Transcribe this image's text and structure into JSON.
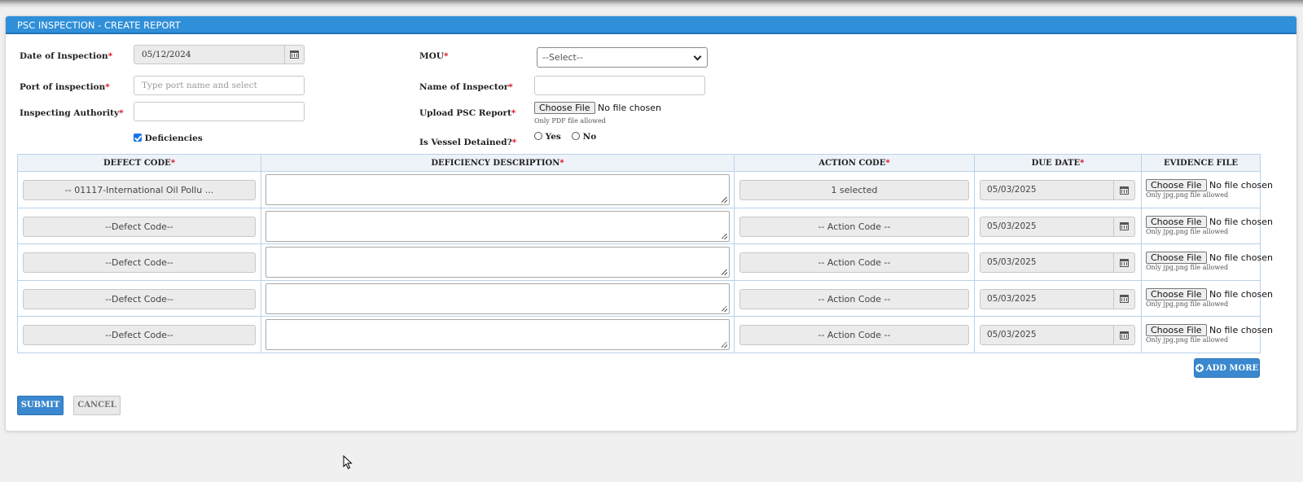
{
  "panel_title": "PSC INSPECTION - CREATE REPORT",
  "form": {
    "date_label": "Date of Inspection",
    "date_value": "05/12/2024",
    "port_label": "Port of inspection",
    "port_placeholder": "Type port name and select",
    "authority_label": "Inspecting Authority",
    "deficiencies_label": "Deficiencies",
    "deficiencies_checked": true,
    "mou_label": "MOU",
    "mou_selected": "--Select--",
    "inspector_label": "Name of Inspector",
    "upload_label": "Upload PSC Report",
    "upload_button": "Choose File",
    "upload_status": "No file chosen",
    "upload_hint": "Only PDF file allowed",
    "detained_label": "Is Vessel Detained?",
    "detained_yes": "Yes",
    "detained_no": "No",
    "required_mark": "*"
  },
  "table": {
    "headers": {
      "defect_code": "DEFECT CODE",
      "description": "DEFICIENCY DESCRIPTION",
      "action_code": "ACTION CODE",
      "due_date": "DUE DATE",
      "evidence": "EVIDENCE FILE"
    },
    "rows": [
      {
        "defect": "-- 01117-International Oil Pollu ...",
        "action": "1 selected",
        "due": "05/03/2025",
        "file_button": "Choose File",
        "file_status": "No file chosen",
        "file_hint": "Only jpg,png file allowed"
      },
      {
        "defect": "--Defect Code--",
        "action": "-- Action Code --",
        "due": "05/03/2025",
        "file_button": "Choose File",
        "file_status": "No file chosen",
        "file_hint": "Only jpg,png file allowed"
      },
      {
        "defect": "--Defect Code--",
        "action": "-- Action Code --",
        "due": "05/03/2025",
        "file_button": "Choose File",
        "file_status": "No file chosen",
        "file_hint": "Only jpg,png file allowed"
      },
      {
        "defect": "--Defect Code--",
        "action": "-- Action Code --",
        "due": "05/03/2025",
        "file_button": "Choose File",
        "file_status": "No file chosen",
        "file_hint": "Only jpg,png file allowed"
      },
      {
        "defect": "--Defect Code--",
        "action": "-- Action Code --",
        "due": "05/03/2025",
        "file_button": "Choose File",
        "file_status": "No file chosen",
        "file_hint": "Only jpg,png file allowed"
      }
    ]
  },
  "buttons": {
    "add_more": "ADD MORE",
    "submit": "SUBMIT",
    "cancel": "CANCEL"
  },
  "icons": {
    "calendar": "calendar-icon",
    "add": "plus-circle-icon",
    "chevron": "chevron-down-icon",
    "cursor": "mouse-pointer-icon"
  },
  "colors": {
    "header_blue": "#2f8fd8",
    "button_blue": "#3a88cf",
    "required_red": "#d9001b",
    "table_border": "#b9d2ea"
  }
}
